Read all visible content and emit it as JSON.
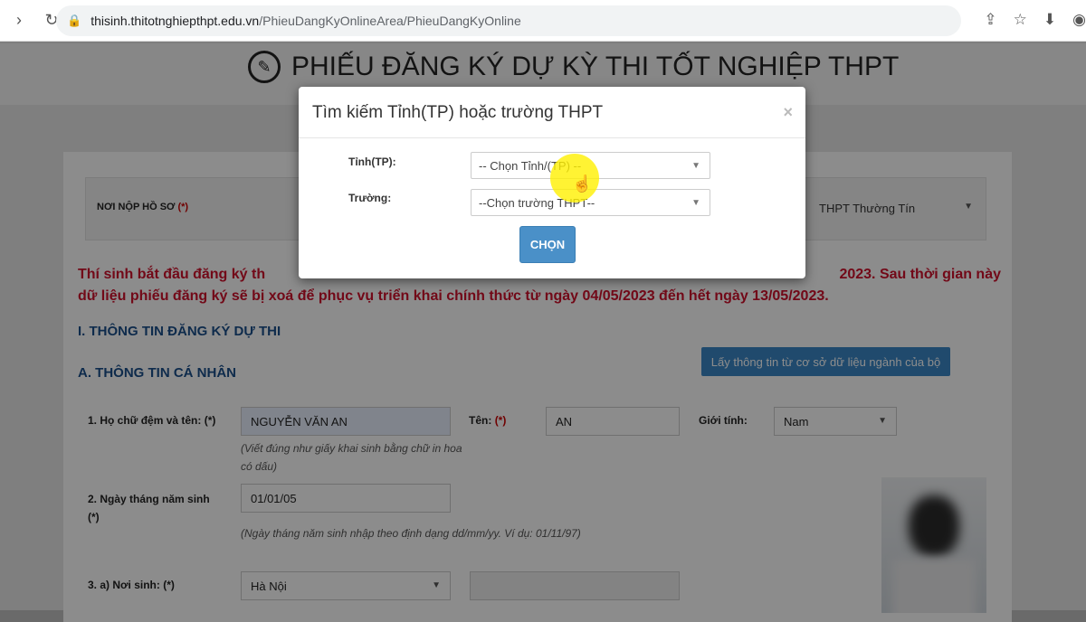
{
  "browser": {
    "url_host": "thisinh.thitotnghiepthpt.edu.vn",
    "url_path": "/PhieuDangKyOnlineArea/PhieuDangKyOnline"
  },
  "header": {
    "title": "PHIẾU ĐĂNG KÝ DỰ KỲ THI TỐT NGHIỆP THPT"
  },
  "form": {
    "noi_nop_label": "NƠI NỘP HỒ SƠ",
    "required": "(*)",
    "noi_nop_value": "THPT Thường Tín",
    "warning_line1": "Thí sinh bắt đầu đăng ký th",
    "warning_line1_end": "2023. Sau thời gian này",
    "warning_line2": "dữ liệu phiếu đăng ký sẽ bị xoá để phục vụ triển khai chính thức từ ngày 04/05/2023 đến hết ngày 13/05/2023.",
    "section1": "I. THÔNG TIN ĐĂNG KÝ DỰ THI",
    "sectionA": "A. THÔNG TIN CÁ NHÂN",
    "fetch_button": "Lấy thông tin từ cơ sở dữ liệu ngành của bộ",
    "fullname_label": "1. Họ chữ đệm và tên: (*)",
    "fullname_value": "NGUYỄN VĂN AN",
    "fullname_hint": "(Viết đúng như giấy khai sinh bằng chữ in hoa có dấu)",
    "ten_label": "Tên:",
    "ten_value": "AN",
    "gender_label": "Giới tính:",
    "gender_value": "Nam",
    "dob_label": "2. Ngày tháng năm sinh (*)",
    "dob_value": "01/01/05",
    "dob_hint": "(Ngày tháng năm sinh nhập theo định dạng dd/mm/yy. Ví dụ: 01/11/97)",
    "pob_label": "3. a) Nơi sinh: (*)",
    "pob_value": "Hà Nội"
  },
  "modal": {
    "title": "Tìm kiếm Tỉnh(TP) hoặc trường THPT",
    "close": "×",
    "province_label": "Tỉnh(TP):",
    "province_value": "-- Chọn Tỉnh/(TP) --",
    "school_label": "Trường:",
    "school_value": "--Chọn trường THPT--",
    "choose_button": "CHỌN"
  }
}
